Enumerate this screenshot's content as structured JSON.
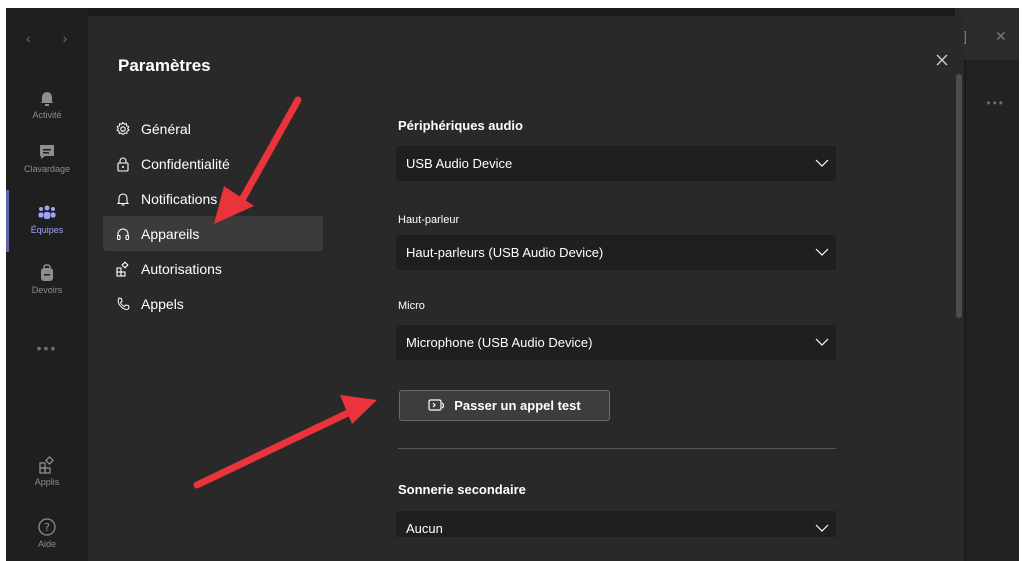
{
  "window": {
    "title": "Paramètres",
    "nav_arrows": "‹ ›",
    "top_right_glyphs": [
      "]",
      "✕"
    ]
  },
  "rail": {
    "items": [
      {
        "label": "Activité",
        "icon": "bell-icon"
      },
      {
        "label": "Clavardage",
        "icon": "chat-icon"
      },
      {
        "label": "Équipes",
        "icon": "teams-icon",
        "active": true
      },
      {
        "label": "Devoirs",
        "icon": "backpack-icon"
      },
      {
        "label": "Applis",
        "icon": "apps-icon"
      },
      {
        "label": "Aide",
        "icon": "help-icon"
      }
    ],
    "more": "•••"
  },
  "settings_menu": [
    {
      "label": "Général",
      "icon": "gear-icon"
    },
    {
      "label": "Confidentialité",
      "icon": "lock-icon"
    },
    {
      "label": "Notifications",
      "icon": "bell-icon"
    },
    {
      "label": "Appareils",
      "icon": "headset-icon",
      "selected": true
    },
    {
      "label": "Autorisations",
      "icon": "apps-icon"
    },
    {
      "label": "Appels",
      "icon": "phone-icon"
    }
  ],
  "audio": {
    "section_title": "Périphériques audio",
    "device_value": "USB Audio Device",
    "speaker_label": "Haut-parleur",
    "speaker_value": "Haut-parleurs (USB Audio Device)",
    "mic_label": "Micro",
    "mic_value": "Microphone (USB Audio Device)",
    "test_button": "Passer un appel test"
  },
  "secondary_ring": {
    "section_title": "Sonnerie secondaire",
    "value": "Aucun"
  },
  "colors": {
    "accent": "#6264a7",
    "annotation_arrow": "#e8343a",
    "modal_bg": "#292929",
    "dropdown_bg": "#1f1f1f"
  }
}
